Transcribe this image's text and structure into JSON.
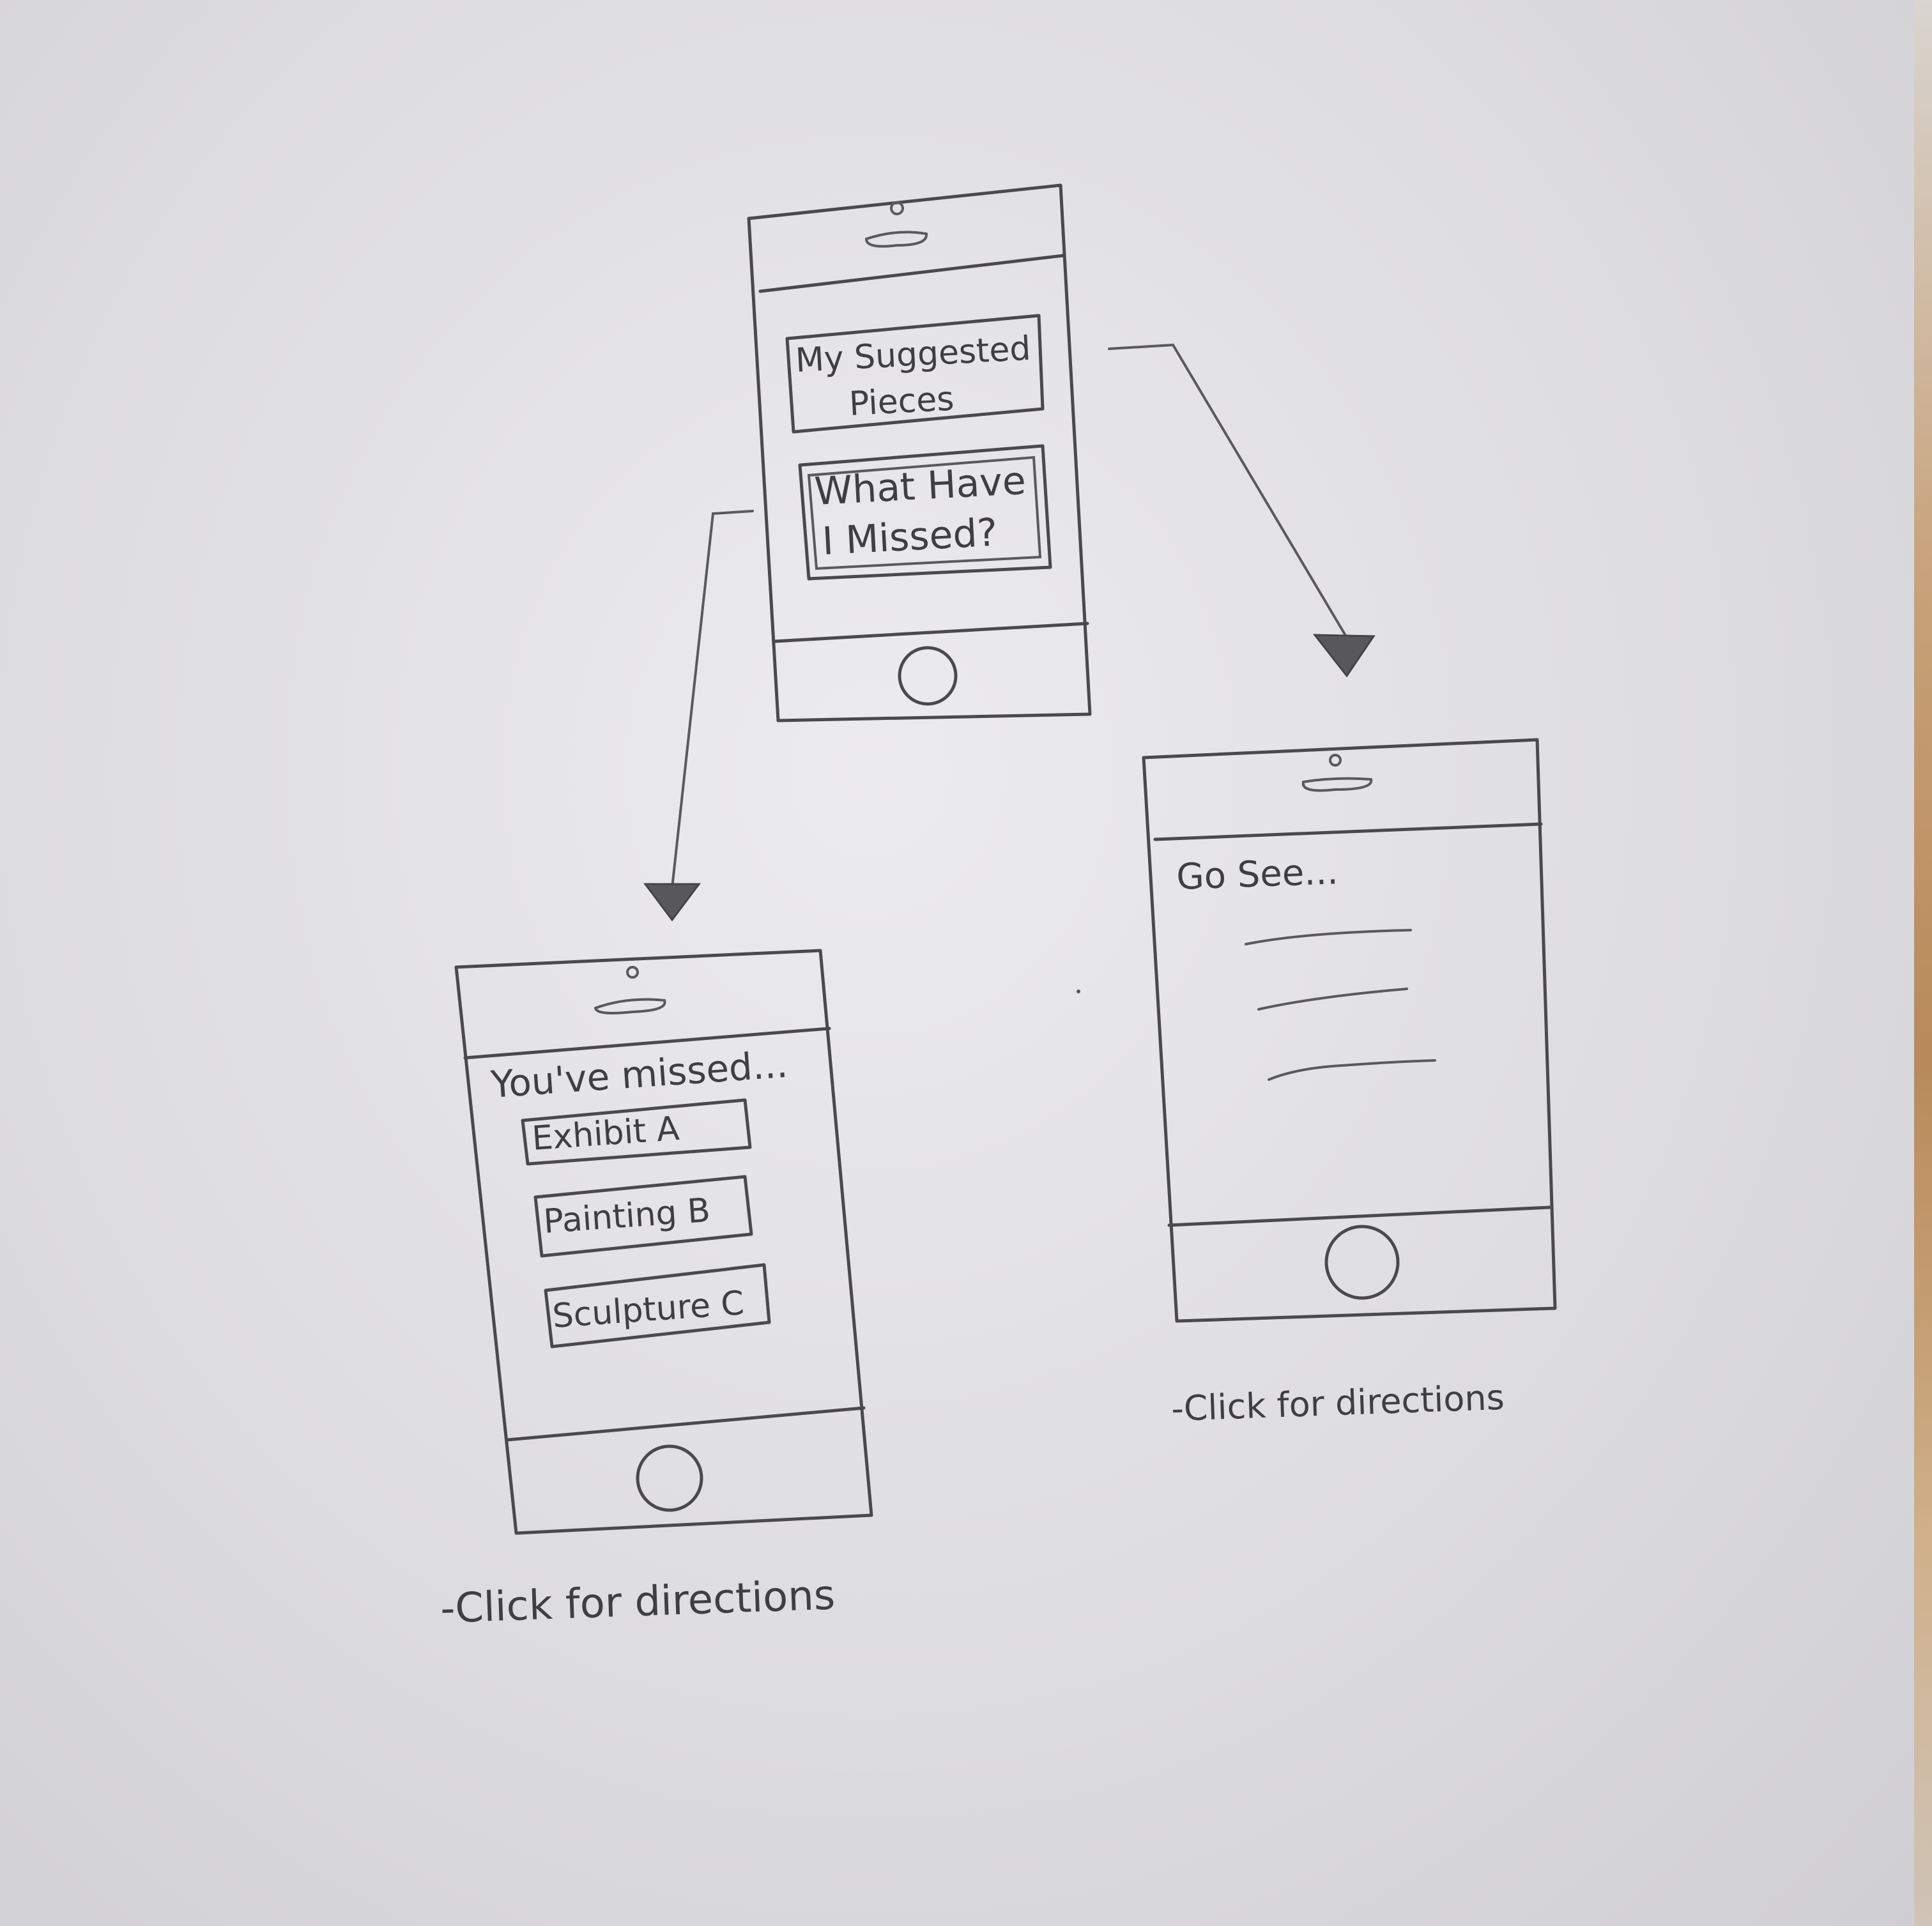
{
  "screens": {
    "home": {
      "button_suggested_line1": "My Suggested",
      "button_suggested_line2": "Pieces",
      "button_missed_line1": "What Have",
      "button_missed_line2": "I Missed?"
    },
    "missed": {
      "heading": "You've missed...",
      "items": [
        "Exhibit A",
        "Painting B",
        "Sculpture C"
      ]
    },
    "suggested": {
      "heading": "Go See..."
    }
  },
  "notes": {
    "missed_note": "-Click for directions",
    "suggested_note": "-Click for directions"
  },
  "colors": {
    "pencil": "#4a4a4d",
    "paper": "#e6e5e8"
  }
}
